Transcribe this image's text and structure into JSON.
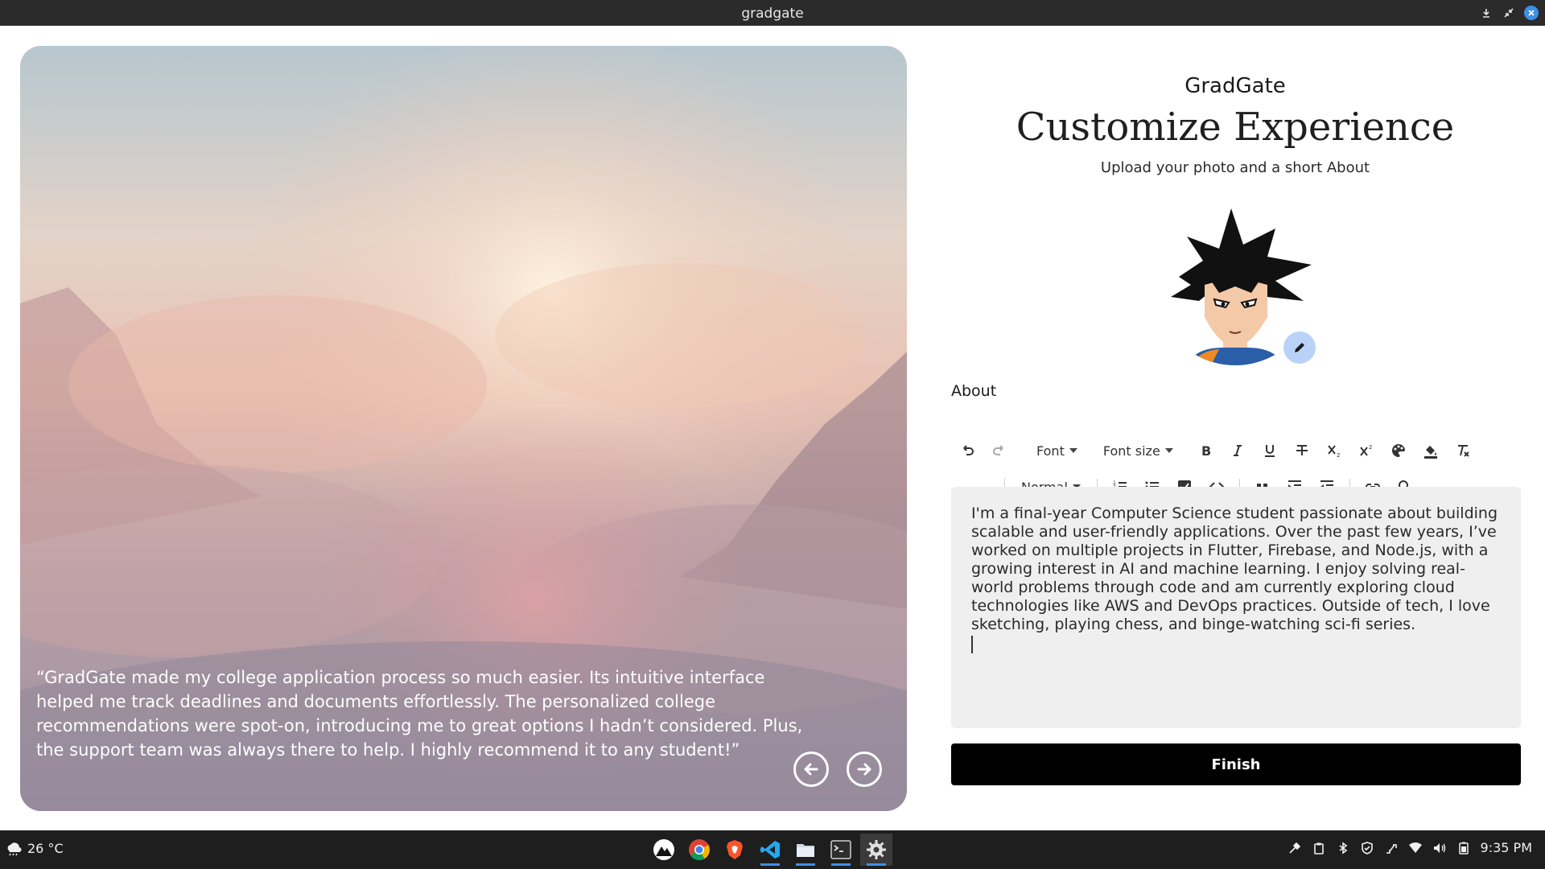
{
  "window": {
    "title": "gradgate"
  },
  "hero": {
    "quote": "“GradGate made my college application process so much easier. Its intuitive interface helped me track deadlines and documents effortlessly. The personalized college recommendations were spot-on, introducing me to great options I hadn’t considered. Plus, the support team was always there to help. I highly recommend it to any student!”",
    "prev_icon": "arrow-left-circle-icon",
    "next_icon": "arrow-right-circle-icon"
  },
  "form": {
    "brand": "GradGate",
    "heading": "Customize Experience",
    "subtitle": "Upload your photo and a short About",
    "about_label": "About",
    "toolbar": {
      "font_label": "Font",
      "font_size_label": "Font size",
      "block_label": "Normal"
    },
    "about_text": "I'm a final-year Computer Science student passionate about building scalable and user-friendly applications. Over the past few years, I’ve worked on multiple projects in Flutter, Firebase, and Node.js, with a growing interest in AI and machine learning. I enjoy solving real-world problems through code and am currently exploring cloud technologies like AWS and DevOps practices. Outside of tech, I love sketching, playing chess, and binge-watching sci-fi series.",
    "finish_label": "Finish"
  },
  "taskbar": {
    "weather": "26 °C",
    "time": "9:35 PM",
    "apps": [
      "mountain-app-icon",
      "chrome-icon",
      "brave-icon",
      "vscode-icon",
      "files-icon",
      "terminal-icon",
      "settings-icon"
    ]
  },
  "colors": {
    "accent": "#3d8fe8",
    "editor_bg": "#efeff0",
    "finish_bg": "#000000",
    "avatar_edit_bg": "#b9d2f8"
  }
}
